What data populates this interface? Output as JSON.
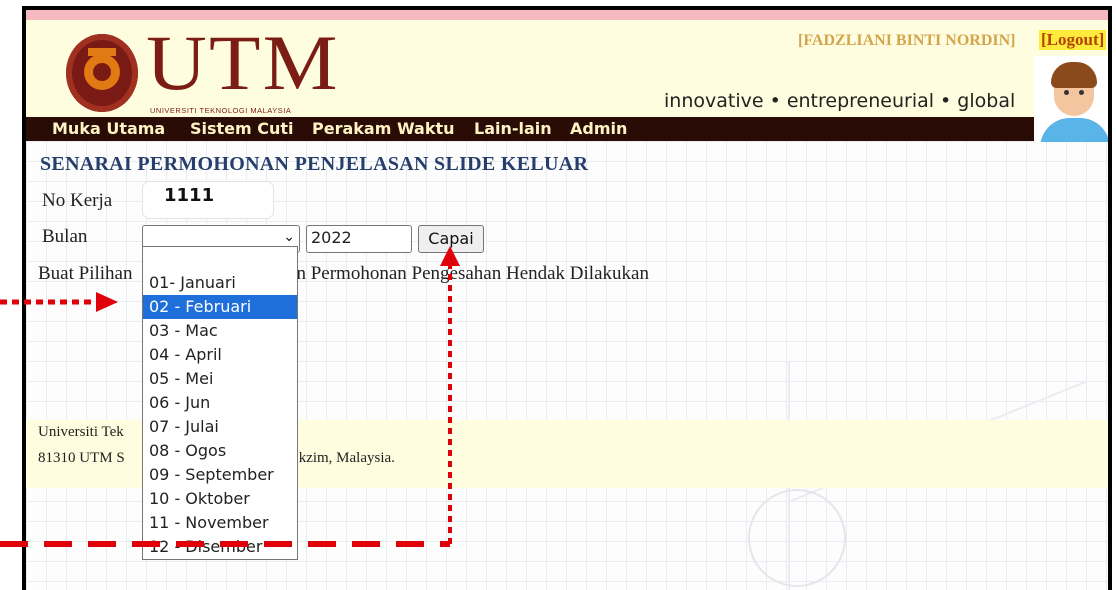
{
  "header": {
    "brand": "UTM",
    "brand_subtitle": "UNIVERSITI TEKNOLOGI MALAYSIA",
    "tagline": "innovative • entrepreneurial • global",
    "user_name": "[FADZLIANI BINTI NORDIN]",
    "logout_label": "[Logout]"
  },
  "nav": {
    "items": [
      "Muka Utama",
      "Sistem Cuti",
      "Perakam Waktu",
      "Lain-lain",
      "Admin"
    ]
  },
  "page": {
    "title": "SENARAI PERMOHONAN PENJELASAN SLIDE KELUAR",
    "no_kerja_label": "No Kerja",
    "no_kerja_value": "1111",
    "bulan_label": "Bulan",
    "year_value": "2022",
    "submit_label": "Capai",
    "instruction_left": "Buat Pilihan",
    "instruction_right": "n Permohonan Pengesahan Hendak Dilakukan"
  },
  "footer": {
    "line1": "Universiti Tek",
    "line2_left": "81310 UTM S",
    "line2_right": "kzim, Malaysia."
  },
  "dropdown": {
    "selected_index": 1,
    "options": [
      "01- Januari",
      "02 - Februari",
      "03 - Mac",
      "04 - April",
      "05 - Mei",
      "06 - Jun",
      "07 - Julai",
      "08 - Ogos",
      "09 - September",
      "10 - Oktober",
      "11 - November",
      "12 - Disember"
    ]
  },
  "colors": {
    "accent_red": "#e0000a",
    "nav_bg": "#2a0c06",
    "selected_option": "#1e6fd9",
    "title_blue": "#253e6b"
  }
}
